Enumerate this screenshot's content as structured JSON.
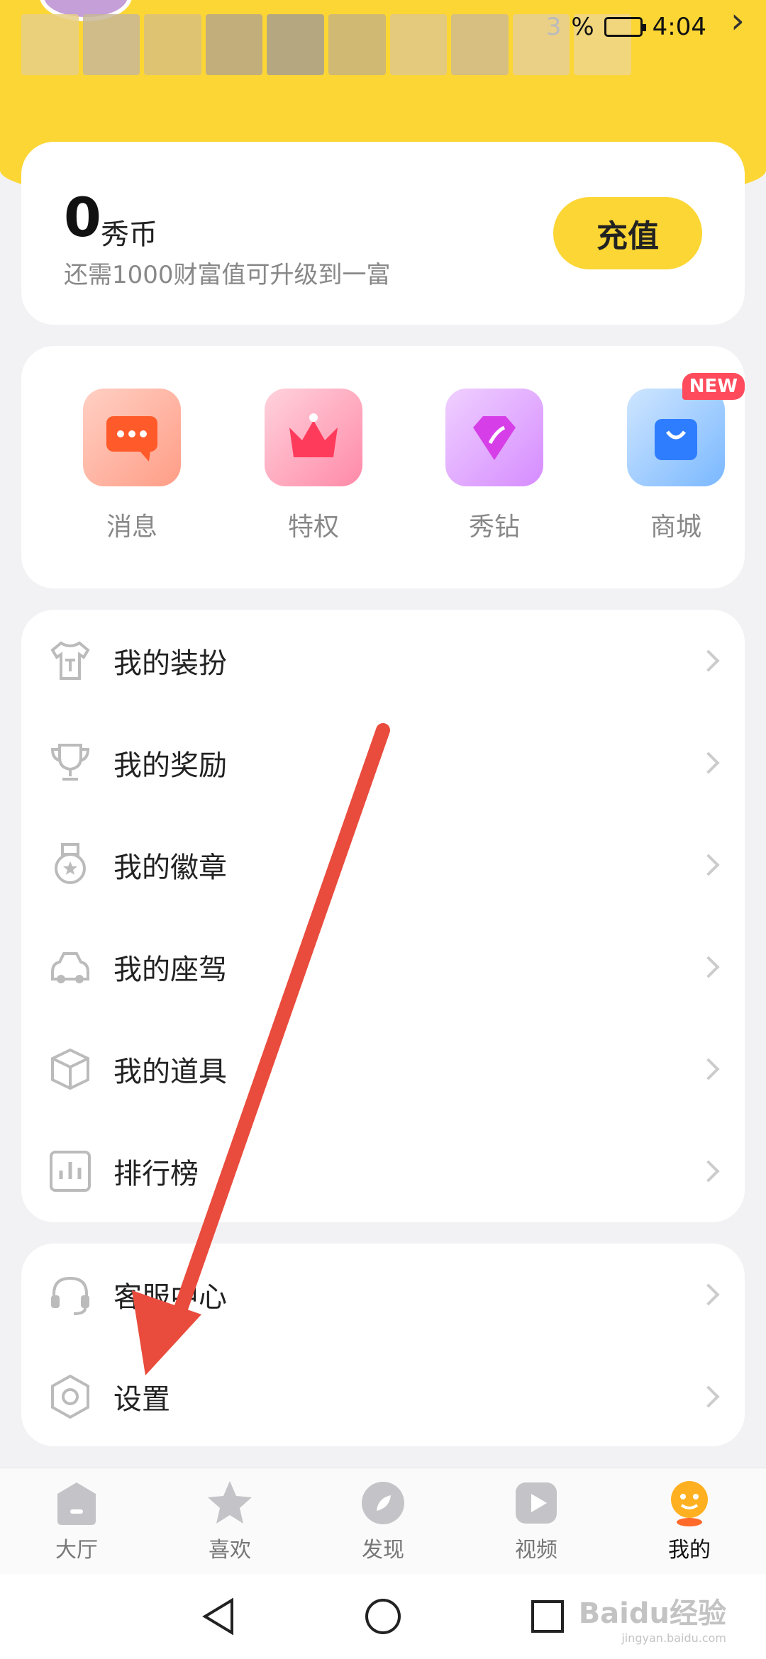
{
  "status_bar": {
    "battery_pct_fragment": "%",
    "time": "4:04",
    "trailing_digit": "3"
  },
  "balance": {
    "amount": "0",
    "unit": "秀币",
    "hint": "还需1000财富值可升级到一富",
    "recharge_label": "充值"
  },
  "shortcuts": [
    {
      "label": "消息",
      "icon": "message-icon"
    },
    {
      "label": "特权",
      "icon": "crown-icon"
    },
    {
      "label": "秀钻",
      "icon": "diamond-icon"
    },
    {
      "label": "商城",
      "icon": "shopping-bag-icon",
      "badge": "NEW"
    }
  ],
  "menu": [
    {
      "label": "我的装扮",
      "icon": "tshirt-icon"
    },
    {
      "label": "我的奖励",
      "icon": "trophy-icon"
    },
    {
      "label": "我的徽章",
      "icon": "medal-icon"
    },
    {
      "label": "我的座驾",
      "icon": "car-icon"
    },
    {
      "label": "我的道具",
      "icon": "box-icon"
    },
    {
      "label": "排行榜",
      "icon": "bar-chart-icon"
    }
  ],
  "support_menu": [
    {
      "label": "客服中心",
      "icon": "headset-icon"
    },
    {
      "label": "设置",
      "icon": "settings-hexagon-icon"
    }
  ],
  "tabs": [
    {
      "label": "大厅",
      "icon": "home-icon"
    },
    {
      "label": "喜欢",
      "icon": "star-icon"
    },
    {
      "label": "发现",
      "icon": "compass-icon"
    },
    {
      "label": "视频",
      "icon": "play-icon"
    },
    {
      "label": "我的",
      "icon": "mascot-icon",
      "active": true
    }
  ],
  "watermark": {
    "brand": "Baidu经验",
    "url": "jingyan.baidu.com"
  },
  "colors": {
    "accent_yellow": "#fcd634",
    "annotation_arrow": "#e94b3c",
    "new_badge": "#ff4b5c"
  }
}
